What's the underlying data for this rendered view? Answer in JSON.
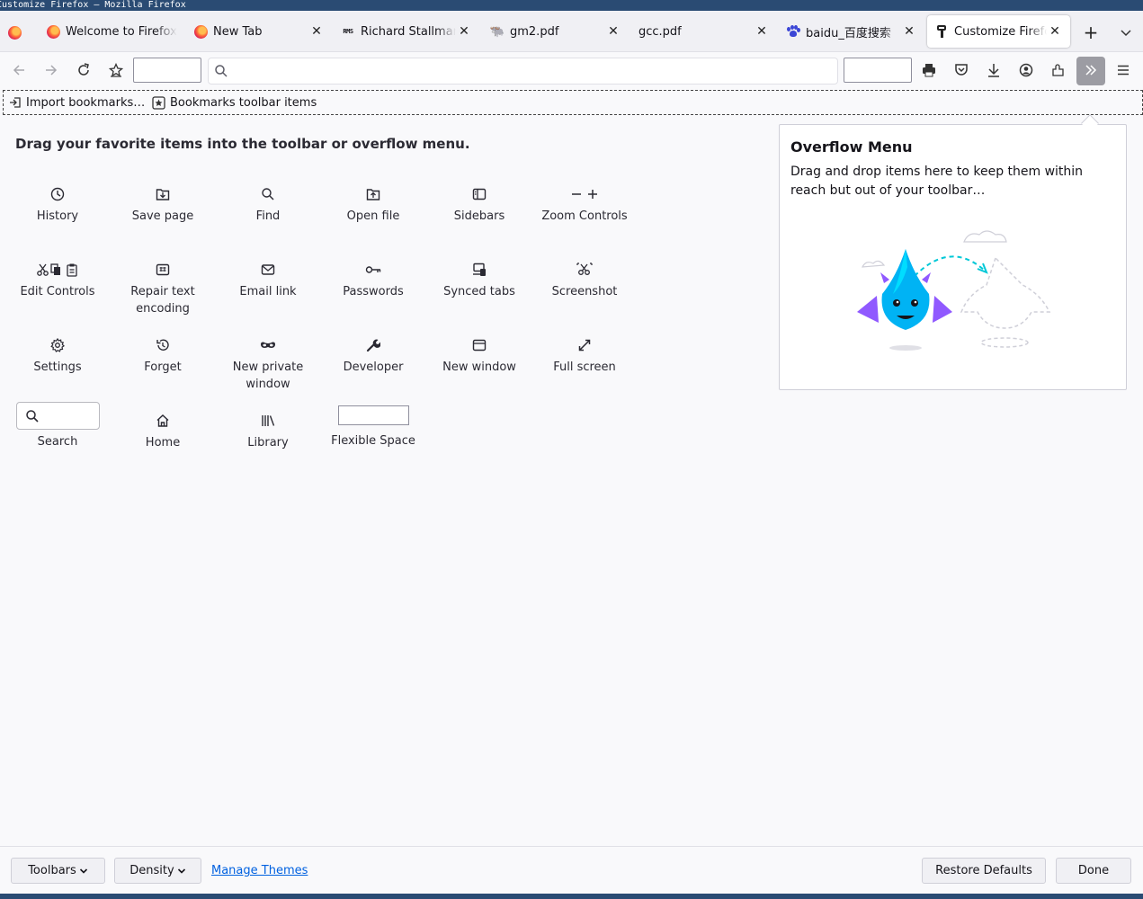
{
  "window_title": "Customize Firefox — Mozilla Firefox",
  "tabs": [
    {
      "title": "Welcome to Firefox",
      "icon": "firefox-icon"
    },
    {
      "title": "New Tab",
      "icon": "firefox-icon"
    },
    {
      "title": "Richard Stallman",
      "icon": "rms-icon",
      "icon_text": "RMS"
    },
    {
      "title": "gm2.pdf",
      "icon": "gnu-icon"
    },
    {
      "title": "gcc.pdf",
      "icon": "none"
    },
    {
      "title": "baidu_百度搜索",
      "icon": "baidu-icon"
    },
    {
      "title": "Customize Firefox",
      "icon": "paintbrush-icon",
      "selected": true
    }
  ],
  "bookmarks": {
    "import_label": "Import bookmarks…",
    "toolbar_items_label": "Bookmarks toolbar items"
  },
  "customize": {
    "heading": "Drag your favorite items into the toolbar or overflow menu.",
    "items": [
      {
        "label": "History",
        "icon": "clock-icon"
      },
      {
        "label": "Save page",
        "icon": "save-page-icon"
      },
      {
        "label": "Find",
        "icon": "search-icon"
      },
      {
        "label": "Open file",
        "icon": "folder-icon"
      },
      {
        "label": "Sidebars",
        "icon": "sidebar-icon"
      },
      {
        "label": "Zoom Controls",
        "icon": "zoom-icon"
      },
      {
        "label": "Edit Controls",
        "icon": "cut-copy-paste-icon"
      },
      {
        "label": "Repair text encoding",
        "icon": "text-encoding-icon"
      },
      {
        "label": "Email link",
        "icon": "envelope-icon"
      },
      {
        "label": "Passwords",
        "icon": "key-icon"
      },
      {
        "label": "Synced tabs",
        "icon": "synced-tabs-icon"
      },
      {
        "label": "Screenshot",
        "icon": "screenshot-icon"
      },
      {
        "label": "Settings",
        "icon": "gear-icon"
      },
      {
        "label": "Forget",
        "icon": "forget-icon"
      },
      {
        "label": "New private window",
        "icon": "mask-icon"
      },
      {
        "label": "Developer",
        "icon": "wrench-icon"
      },
      {
        "label": "New window",
        "icon": "window-icon"
      },
      {
        "label": "Full screen",
        "icon": "fullscreen-icon"
      },
      {
        "label": "Search",
        "icon": "search-icon"
      },
      {
        "label": "Home",
        "icon": "home-icon"
      },
      {
        "label": "Library",
        "icon": "library-icon"
      },
      {
        "label": "Flexible Space",
        "icon": "none"
      }
    ]
  },
  "overflow_panel": {
    "title": "Overflow Menu",
    "description": "Drag and drop items here to keep them within reach but out of your toolbar…"
  },
  "footer": {
    "toolbars_label": "Toolbars",
    "density_label": "Density",
    "manage_themes_label": "Manage Themes",
    "restore_defaults_label": "Restore Defaults",
    "done_label": "Done"
  },
  "colors": {
    "titlebar": "#2a4b73",
    "link": "#0061e0",
    "overflow_button": "#9c9ca3"
  }
}
